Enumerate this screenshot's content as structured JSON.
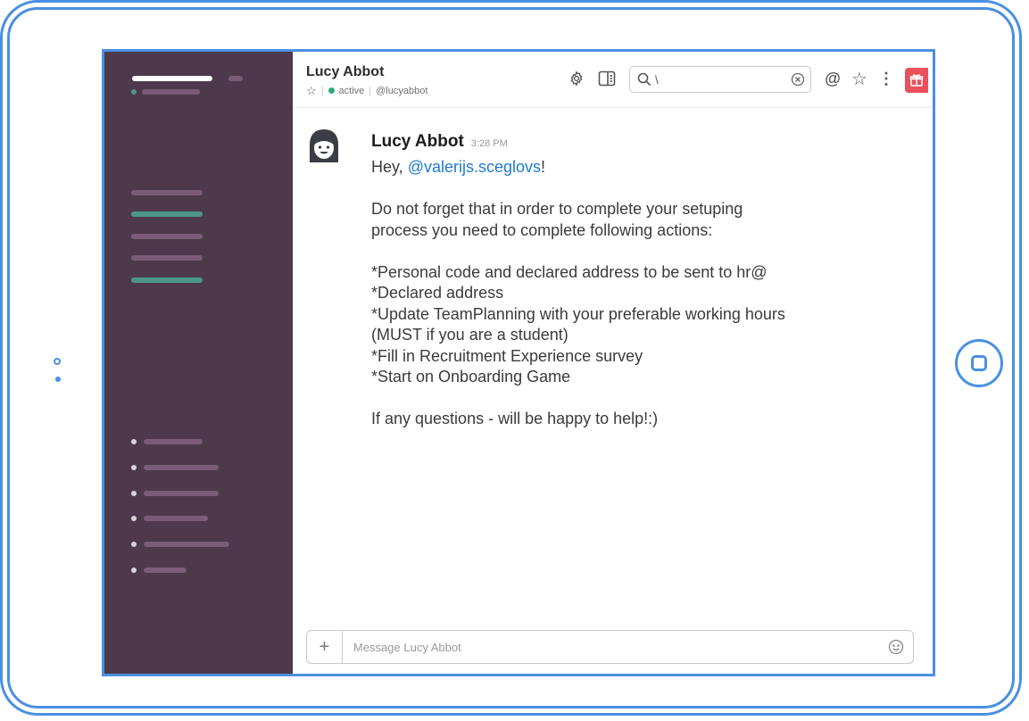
{
  "conversation": {
    "name": "Lucy Abbot",
    "status": "active",
    "handle": "@lucyabbot"
  },
  "search": {
    "value": "\\"
  },
  "message": {
    "sender": "Lucy Abbot",
    "time": "3:28 PM",
    "greeting_prefix": "Hey, ",
    "mention": "@valerijs.sceglovs",
    "greeting_suffix": "!",
    "lines": [
      "Do not forget that in order to complete your setuping",
      "process you need to complete following actions:",
      "",
      "*Personal code and declared address to be sent to hr@",
      "*Declared address",
      "*Update TeamPlanning with your preferable working hours",
      "(MUST if you are a student)",
      "*Fill in Recruitment Experience survey",
      "*Start on Onboarding Game",
      "",
      "If any questions - will be happy to help!:)"
    ]
  },
  "composer": {
    "placeholder": "Message Lucy Abbot"
  },
  "icons": {
    "header": [
      "gear-icon",
      "sidebar-panel-icon",
      "search-icon",
      "clear-icon",
      "mention-icon",
      "star-icon",
      "more-vertical-icon",
      "gift-icon"
    ],
    "composer": [
      "plus-icon",
      "emoji-icon"
    ]
  },
  "colors": {
    "sidebar": "#4d394b",
    "accent_green": "#4c9689",
    "mention_link": "#1f7ad3",
    "gift": "#e8505b",
    "frame": "#4a90e2",
    "status_active": "#2bac76"
  }
}
